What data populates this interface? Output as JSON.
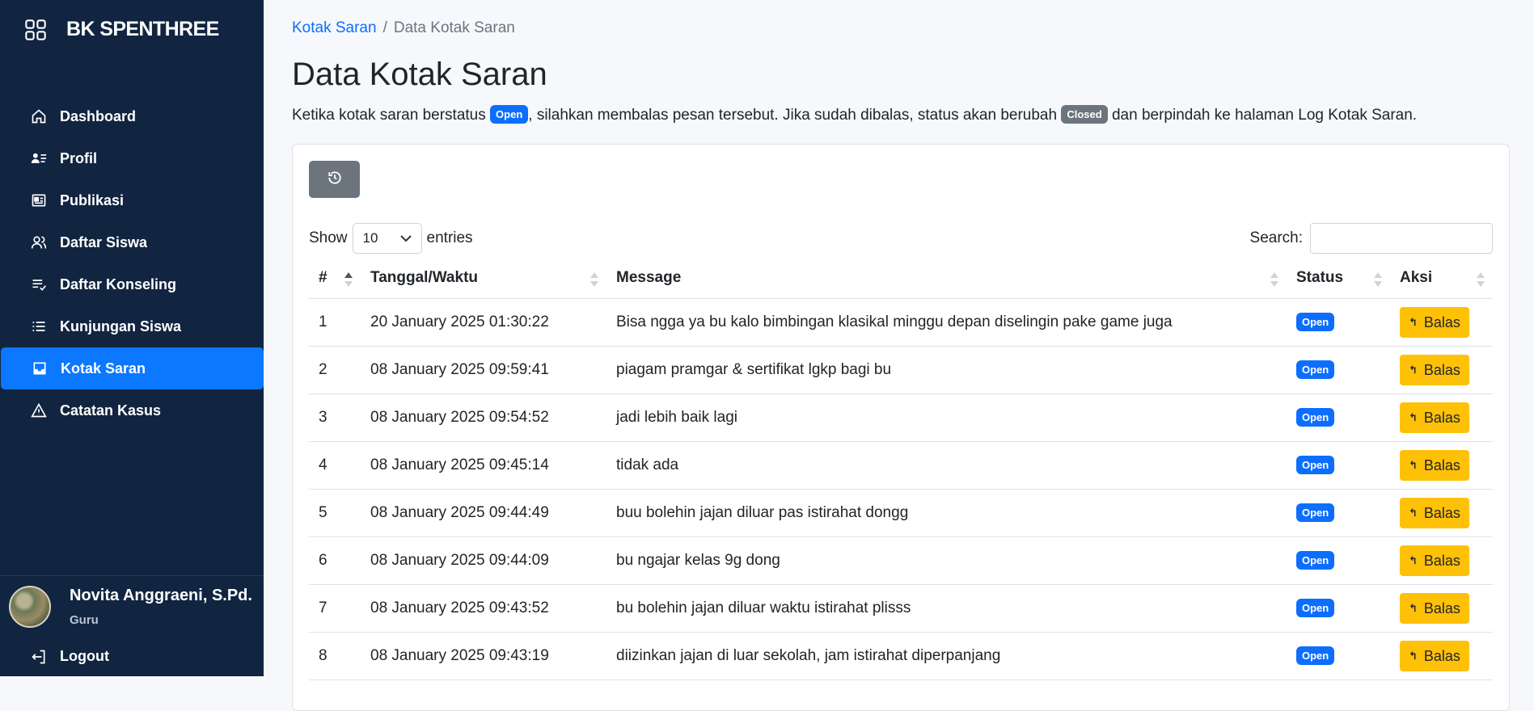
{
  "sidebar": {
    "brand": "BK SPENTHREE",
    "items": [
      {
        "label": "Dashboard",
        "icon": "home-icon"
      },
      {
        "label": "Profil",
        "icon": "profile-card-icon"
      },
      {
        "label": "Publikasi",
        "icon": "newspaper-icon"
      },
      {
        "label": "Daftar Siswa",
        "icon": "users-icon"
      },
      {
        "label": "Daftar Konseling",
        "icon": "list-check-icon"
      },
      {
        "label": "Kunjungan Siswa",
        "icon": "list-icon"
      },
      {
        "label": "Kotak Saran",
        "icon": "inbox-icon",
        "active": true
      },
      {
        "label": "Catatan Kasus",
        "icon": "warning-icon"
      }
    ],
    "user": {
      "name": "Novita Anggraeni, S.Pd.",
      "role": "Guru"
    },
    "logout_label": "Logout"
  },
  "breadcrumb": {
    "parent": "Kotak Saran",
    "separator": "/",
    "current": "Data Kotak Saran"
  },
  "page": {
    "title": "Data Kotak Saran",
    "info": {
      "part1": "Ketika kotak saran berstatus",
      "badge_open": "Open",
      "part2": ", silahkan membalas pesan tersebut. Jika sudah dibalas, status akan berubah",
      "badge_closed": "Closed",
      "part3": "dan berpindah ke halaman Log Kotak Saran."
    }
  },
  "table_controls": {
    "show_label": "Show",
    "entries_value": "10",
    "entries_label": "entries",
    "search_label": "Search:",
    "search_value": ""
  },
  "table": {
    "headers": [
      "#",
      "Tanggal/Waktu",
      "Message",
      "Status",
      "Aksi"
    ],
    "rows": [
      {
        "no": "1",
        "datetime": "20 January 2025 01:30:22",
        "message": "Bisa ngga ya bu kalo bimbingan klasikal minggu depan diselingin pake game juga",
        "status": "Open",
        "action": "Balas"
      },
      {
        "no": "2",
        "datetime": "08 January 2025 09:59:41",
        "message": "piagam pramgar & sertifikat lgkp bagi bu",
        "status": "Open",
        "action": "Balas"
      },
      {
        "no": "3",
        "datetime": "08 January 2025 09:54:52",
        "message": "jadi lebih baik lagi",
        "status": "Open",
        "action": "Balas"
      },
      {
        "no": "4",
        "datetime": "08 January 2025 09:45:14",
        "message": "tidak ada",
        "status": "Open",
        "action": "Balas"
      },
      {
        "no": "5",
        "datetime": "08 January 2025 09:44:49",
        "message": "buu bolehin jajan diluar pas istirahat dongg",
        "status": "Open",
        "action": "Balas"
      },
      {
        "no": "6",
        "datetime": "08 January 2025 09:44:09",
        "message": "bu ngajar kelas 9g dong",
        "status": "Open",
        "action": "Balas"
      },
      {
        "no": "7",
        "datetime": "08 January 2025 09:43:52",
        "message": "bu bolehin jajan diluar waktu istirahat plisss",
        "status": "Open",
        "action": "Balas"
      },
      {
        "no": "8",
        "datetime": "08 January 2025 09:43:19",
        "message": "diizinkan jajan di luar sekolah, jam istirahat diperpanjang",
        "status": "Open",
        "action": "Balas"
      }
    ]
  },
  "colors": {
    "sidebar_bg": "#112540",
    "active": "#0b78ff",
    "primary": "#0d6efd",
    "warning": "#ffc107",
    "secondary": "#6c757d"
  }
}
